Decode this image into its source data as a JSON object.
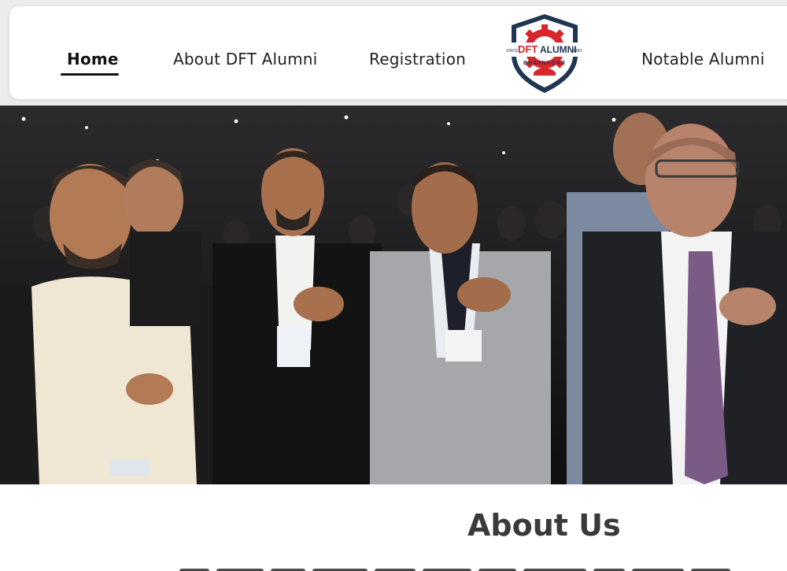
{
  "navbar": {
    "items": [
      {
        "label": "Home",
        "active": true
      },
      {
        "label": "About DFT Alumni",
        "active": false
      },
      {
        "label": "Registration",
        "active": false
      },
      {
        "label": "Notable Alumni",
        "active": false
      }
    ],
    "logo": {
      "text": "DFT",
      "text2": "ALUMNI",
      "since": "SINCE",
      "year": "1983",
      "city": "BHAVNAGAR",
      "colors": {
        "shield": "#1f3552",
        "gear": "#d8262c",
        "accent": "#ffffff"
      }
    }
  },
  "hero": {
    "icon": "event-photo"
  },
  "about": {
    "title": "About Us"
  },
  "colors": {
    "background": "#ececec",
    "navbar": "#ffffff",
    "text": "#222222",
    "heading": "#3a3a3a"
  }
}
